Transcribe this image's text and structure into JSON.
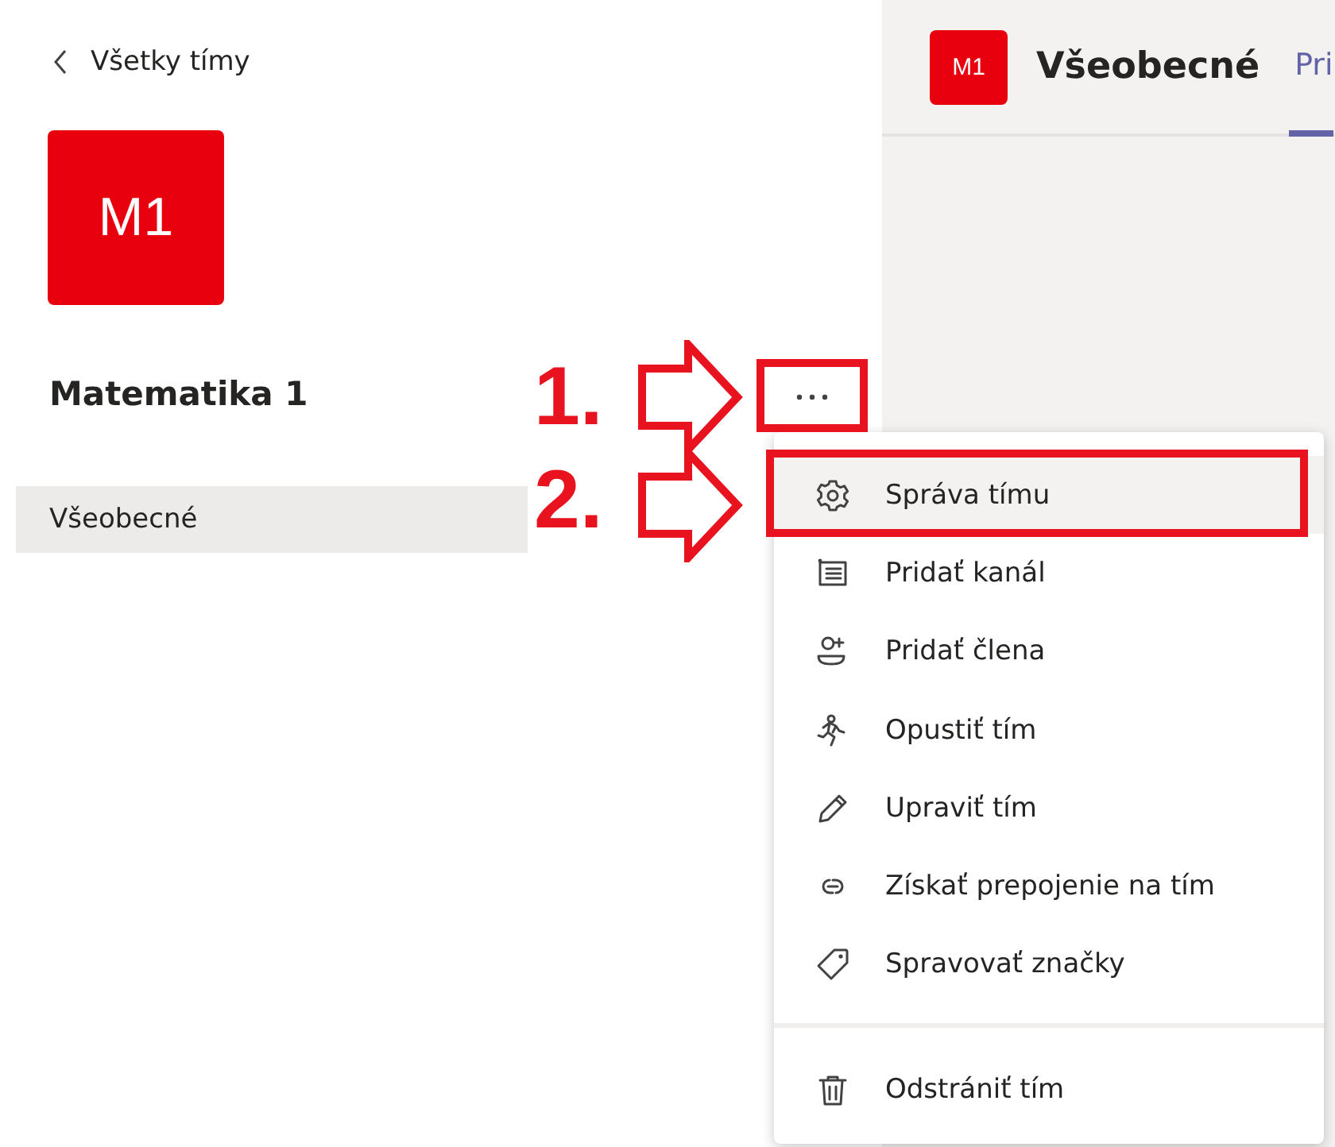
{
  "sidebar": {
    "back_link": "Všetky tímy",
    "team_avatar": "M1",
    "team_name": "Matematika 1",
    "channels": [
      {
        "label": "Všeobecné",
        "selected": true
      }
    ]
  },
  "header": {
    "avatar": "M1",
    "title": "Všeobecné",
    "tabs": [
      {
        "label": "Pri",
        "selected": true
      }
    ]
  },
  "menu": {
    "sections": [
      [
        {
          "label": "Správa tímu",
          "selected": true
        },
        {
          "label": "Pridať kanál",
          "selected": false
        },
        {
          "label": "Pridať člena",
          "selected": false
        },
        {
          "label": "Opustiť tím",
          "selected": false
        },
        {
          "label": "Upraviť tím",
          "selected": false
        },
        {
          "label": "Získať prepojenie na tím",
          "selected": false
        },
        {
          "label": "Spravovať značky",
          "selected": false
        }
      ],
      [
        {
          "label": "Odstrániť tím",
          "selected": false
        }
      ]
    ]
  },
  "annotations": [
    {
      "label": "1."
    },
    {
      "label": "2."
    }
  ]
}
